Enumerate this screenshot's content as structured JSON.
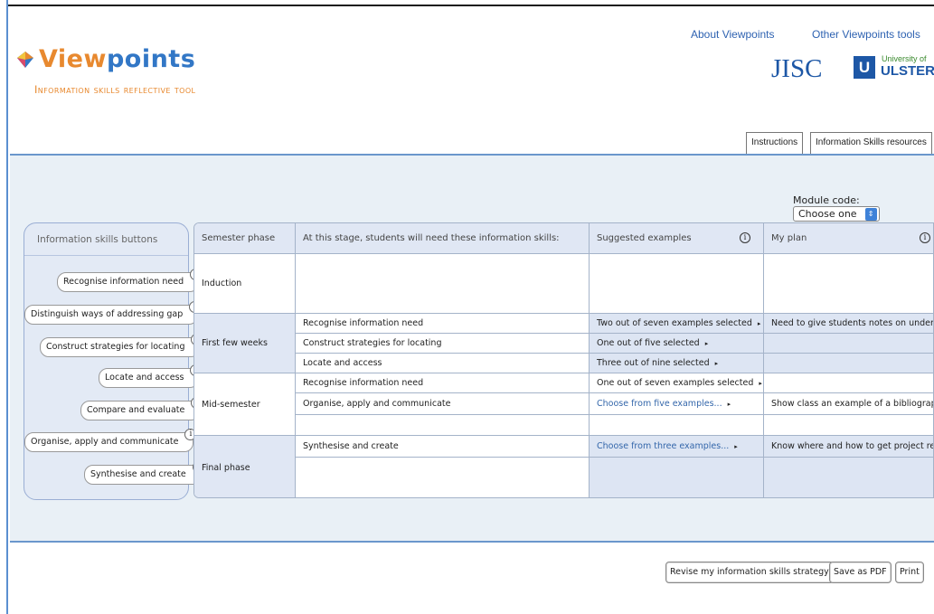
{
  "header": {
    "logo_view": "View",
    "logo_points": "points",
    "subtitle": "Information skills reflective tool",
    "links": [
      "About Viewpoints",
      "Other Viewpoints tools"
    ],
    "jisc": "JISC",
    "uu_mark": "U",
    "uu_small": "University of",
    "uu_big": "ULSTER",
    "tabs": [
      "Instructions",
      "Information Skills resources"
    ]
  },
  "module": {
    "label": "Module code:",
    "value": "Choose one"
  },
  "skills_panel": {
    "title": "Information skills buttons",
    "buttons": [
      "Recognise information need",
      "Distinguish ways of addressing gap",
      "Construct strategies for locating",
      "Locate and access",
      "Compare and evaluate",
      "Organise, apply and communicate",
      "Synthesise and create"
    ],
    "info_glyph": "i"
  },
  "table": {
    "headers": [
      "Semester phase",
      "At this stage, students will need these information skills:",
      "Suggested examples",
      "My plan"
    ],
    "info_glyph": "i",
    "phases": [
      "Induction",
      "First few weeks",
      "Mid-semester",
      "Final phase"
    ],
    "rows": [
      {
        "skill": "Recognise information need",
        "example": "Two out of seven examples selected",
        "plan": "Need to give students notes on underst..."
      },
      {
        "skill": "Construct strategies for locating",
        "example": "One out of five selected",
        "plan": ""
      },
      {
        "skill": "Locate and access",
        "example": "Three out of nine selected",
        "plan": ""
      },
      {
        "skill": "Recognise information need",
        "example": "One out of seven examples selected",
        "plan": ""
      },
      {
        "skill": "Organise, apply and communicate",
        "example": "Choose from five examples...",
        "plan": "Show class an example of a bibliography..."
      },
      {
        "skill": "Synthesise and create",
        "example": "Choose from three examples...",
        "plan": "Know where and how to get project res..."
      }
    ],
    "arrow": "▸"
  },
  "footer": {
    "buttons": [
      "Revise my information skills strategy",
      "Save as PDF",
      "Print"
    ]
  },
  "colors": {
    "accent_orange": "#e8892f",
    "brand_blue": "#3277c6",
    "band": "#e9f0f6"
  }
}
